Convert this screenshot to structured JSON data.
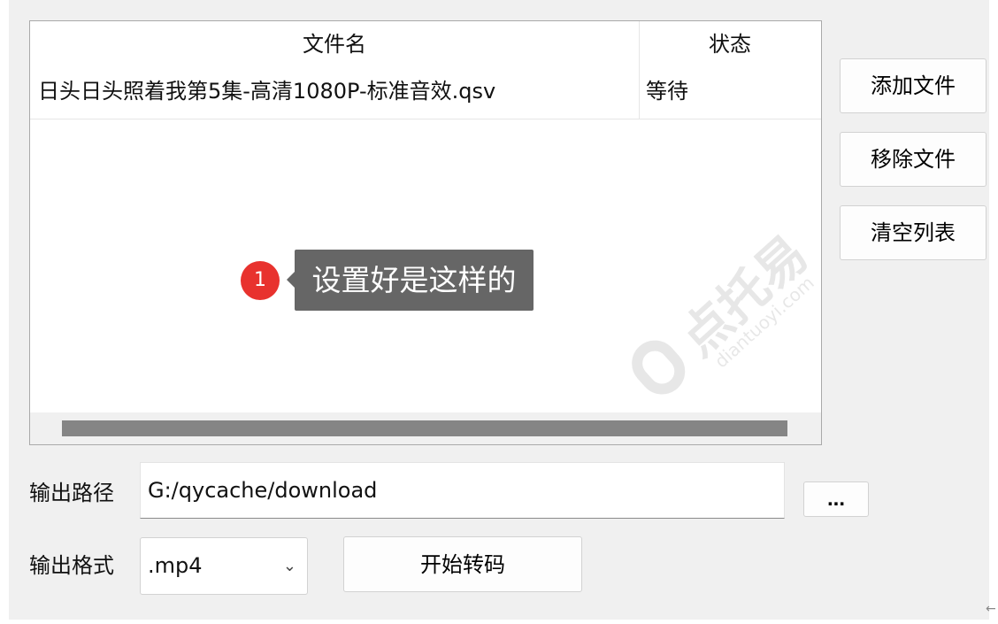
{
  "table": {
    "columns": [
      "文件名",
      "状态"
    ],
    "rows": [
      {
        "name": "日头日头照着我第5集-高清1080P-标准音效.qsv",
        "status": "等待"
      }
    ]
  },
  "annotation": {
    "number": "1",
    "text": "设置好是这样的"
  },
  "watermark": {
    "text": "点托易",
    "sub": "diantuoyi.com"
  },
  "buttons": {
    "add": "添加文件",
    "remove": "移除文件",
    "clear": "清空列表",
    "browse": "...",
    "start": "开始转码"
  },
  "output": {
    "path_label": "输出路径",
    "path_value": "G:/qycache/download",
    "format_label": "输出格式",
    "format_value": ".mp4"
  },
  "icons": {
    "dropdown": "chevron-down-icon",
    "corner": "arrow-left-icon"
  },
  "colors": {
    "window_bg": "#f0f0f0",
    "annotation_badge": "#e8322e",
    "annotation_box": "#666666",
    "scrollbar_thumb": "#858585"
  }
}
